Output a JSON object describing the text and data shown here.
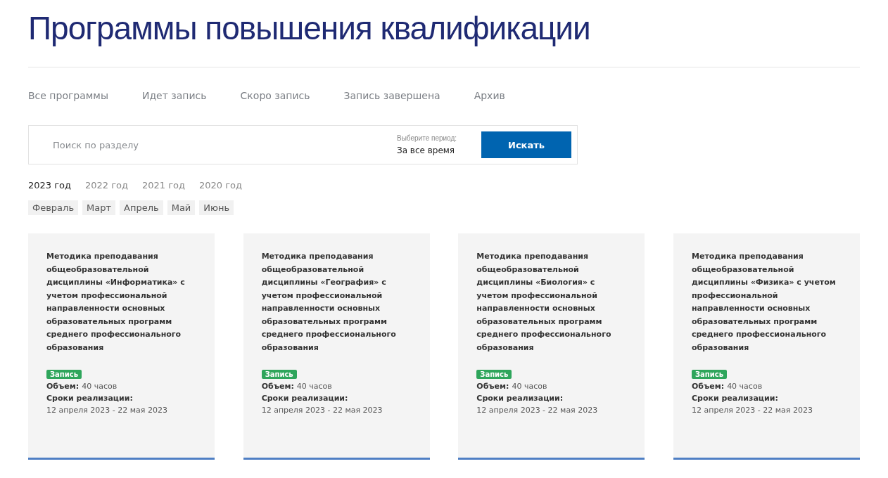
{
  "page_title": "Программы повышения квалификации",
  "tabs": [
    {
      "label": "Все программы",
      "selected": false
    },
    {
      "label": "Идет запись",
      "selected": false
    },
    {
      "label": "Скоро запись",
      "selected": false
    },
    {
      "label": "Запись завершена",
      "selected": false
    },
    {
      "label": "Архив",
      "selected": false
    }
  ],
  "search": {
    "placeholder": "Поиск по разделу",
    "period_label": "Выберите период:",
    "period_value": "За все время",
    "button": "Искать"
  },
  "years": [
    {
      "label": "2023 год",
      "selected": true
    },
    {
      "label": "2022 год",
      "selected": false
    },
    {
      "label": "2021 год",
      "selected": false
    },
    {
      "label": "2020 год",
      "selected": false
    }
  ],
  "months": [
    {
      "label": "Февраль",
      "selected": false
    },
    {
      "label": "Март",
      "selected": false
    },
    {
      "label": "Апрель",
      "selected": false
    },
    {
      "label": "Май",
      "selected": false
    },
    {
      "label": "Июнь",
      "selected": false
    }
  ],
  "cards": [
    {
      "title": "Методика преподавания общеобразовательной дисциплины «Информатика» с учетом профессиональной направленности основных образовательных программ среднего профессионального образования",
      "status": "Запись",
      "volume_label": "Объем:",
      "volume": "40 часов",
      "dates_label": "Сроки реализации:",
      "dates": "12 апреля 2023 - 22 мая 2023"
    },
    {
      "title": "Методика преподавания общеобразовательной дисциплины «География» с учетом профессиональной направленности основных образовательных программ среднего профессионального образования",
      "status": "Запись",
      "volume_label": "Объем:",
      "volume": "40 часов",
      "dates_label": "Сроки реализации:",
      "dates": "12 апреля 2023 - 22 мая 2023"
    },
    {
      "title": "Методика преподавания общеобразовательной дисциплины «Биология» с учетом профессиональной направленности основных образовательных программ среднего профессионального образования",
      "status": "Запись",
      "volume_label": "Объем:",
      "volume": "40 часов",
      "dates_label": "Сроки реализации:",
      "dates": "12 апреля 2023 - 22 мая 2023"
    },
    {
      "title": "Методика преподавания общеобразовательной дисциплины «Физика» с учетом профессиональной направленности основных образовательных программ среднего профессионального образования",
      "status": "Запись",
      "volume_label": "Объем:",
      "volume": "40 часов",
      "dates_label": "Сроки реализации:",
      "dates": "12 апреля 2023 - 22 мая 2023"
    }
  ]
}
